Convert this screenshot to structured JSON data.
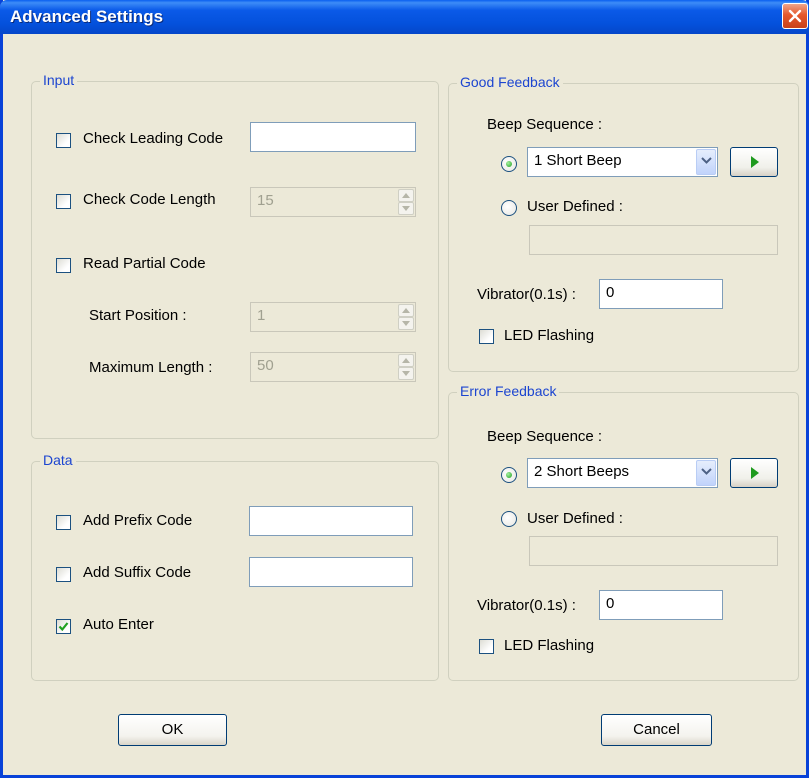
{
  "window": {
    "title": "Advanced Settings"
  },
  "input_group": {
    "legend": "Input",
    "check_leading_code": {
      "label": "Check Leading Code",
      "checked": false,
      "value": ""
    },
    "check_code_length": {
      "label": "Check Code Length",
      "checked": false,
      "value": "15"
    },
    "read_partial_code": {
      "label": "Read Partial Code",
      "checked": false
    },
    "start_position": {
      "label": "Start Position :",
      "value": "1"
    },
    "maximum_length": {
      "label": "Maximum Length :",
      "value": "50"
    }
  },
  "data_group": {
    "legend": "Data",
    "add_prefix_code": {
      "label": "Add Prefix Code",
      "checked": false,
      "value": ""
    },
    "add_suffix_code": {
      "label": "Add Suffix Code",
      "checked": false,
      "value": ""
    },
    "auto_enter": {
      "label": "Auto Enter",
      "checked": true
    }
  },
  "good_feedback": {
    "legend": "Good Feedback",
    "beep_sequence_label": "Beep Sequence :",
    "beep_selected": "1 Short Beep",
    "user_defined_label": "User Defined :",
    "user_defined_value": "",
    "vibrator_label": "Vibrator(0.1s) :",
    "vibrator_value": "0",
    "led_flashing_label": "LED Flashing"
  },
  "error_feedback": {
    "legend": "Error Feedback",
    "beep_sequence_label": "Beep Sequence :",
    "beep_selected": "2 Short Beeps",
    "user_defined_label": "User Defined :",
    "user_defined_value": "",
    "vibrator_label": "Vibrator(0.1s) :",
    "vibrator_value": "0",
    "led_flashing_label": "LED Flashing"
  },
  "buttons": {
    "ok": "OK",
    "cancel": "Cancel"
  },
  "colors": {
    "titlebar": "#0451dc",
    "legend_text": "#1c45d0",
    "dialog_bg": "#ece9d8",
    "close_button": "#e5582d"
  }
}
